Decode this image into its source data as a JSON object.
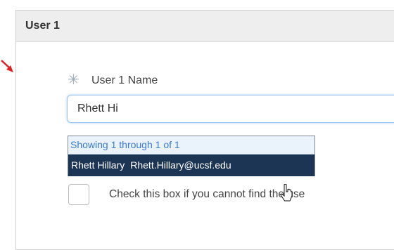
{
  "panel": {
    "title": "User 1"
  },
  "field": {
    "label": "User 1 Name",
    "value": "Rhett Hi",
    "required": true
  },
  "suggestions": {
    "status": "Showing 1 through 1 of 1",
    "items": [
      {
        "name": "Rhett Hillary",
        "email": "Rhett.Hillary@ucsf.edu"
      }
    ]
  },
  "checkbox": {
    "label": "Check this box if you cannot find the use",
    "checked": false
  },
  "colors": {
    "header_bg": "#eeeeee",
    "highlight_bg": "#1c3555",
    "status_text": "#3a7bd5",
    "arrow": "#e02020"
  },
  "icons": {
    "annotation": "red-arrow-icon",
    "required": "asterisk-icon",
    "pointer": "mouse-cursor-icon"
  }
}
